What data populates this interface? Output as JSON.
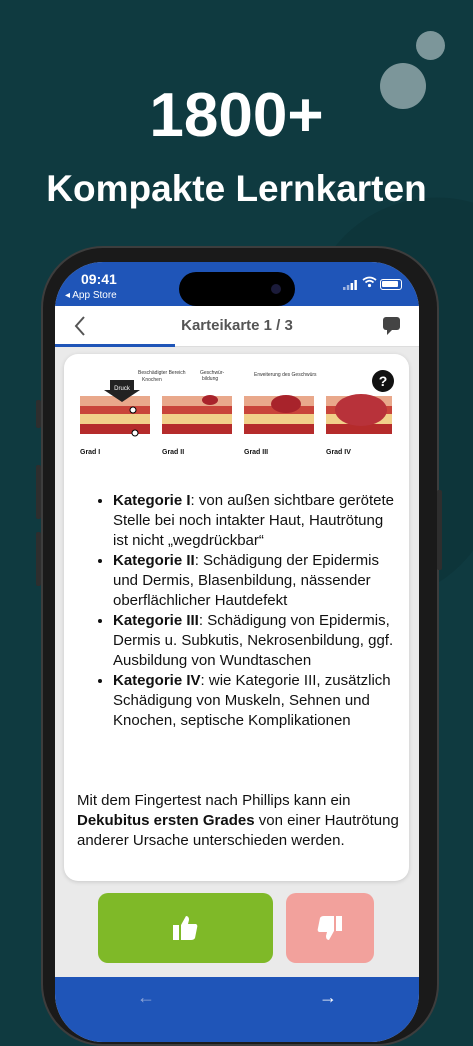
{
  "headline": {
    "number": "1800+",
    "subtitle": "Kompakte Lernkarten"
  },
  "status": {
    "time": "09:41",
    "back_app": "◂ App Store"
  },
  "nav": {
    "title": "Karteikarte 1 / 3"
  },
  "figure": {
    "druck": "Druck",
    "label_bereich": "Beschädigter Bereich",
    "label_knochen": "Knochen",
    "label_geschwuer": "Geschwür-",
    "label_bildung": "bildung",
    "label_erweiterung": "Erweiterung des Geschwürs",
    "grades": [
      "Grad I",
      "Grad II",
      "Grad III",
      "Grad IV"
    ]
  },
  "list": [
    {
      "bold": "Kategorie I",
      "text": ": von außen sichtbare gerötete Stelle bei noch intakter Haut, Hautrötung ist nicht „wegdrückbar“"
    },
    {
      "bold": "Kategorie II",
      "text": ": Schädigung der Epidermis und Dermis, Blasenbildung, nässender oberflächlicher Hautdefekt"
    },
    {
      "bold": "Kategorie III",
      "text": ": Schädigung von Epidermis, Dermis u. Subkutis, Nekrosenbildung, ggf. Ausbildung von Wundtaschen"
    },
    {
      "bold": "Kategorie IV",
      "text": ": wie Kategorie III, zusätzlich Schädigung von Muskeln, Sehnen und Knochen, septische Komplikationen"
    }
  ],
  "paragraph": {
    "before": "Mit dem Fingertest nach Phillips kann ein ",
    "bold": "Dekubitus ersten Grades",
    "after": " von einer Hautrötung anderer Ursache unterschieden werden."
  },
  "help_label": "?",
  "arrows": {
    "prev": "←",
    "next": "→"
  },
  "colors": {
    "background": "#0f3a40",
    "app_blue": "#1f55b8",
    "like_green": "#7fb928",
    "dislike_pink": "#f2a19c"
  },
  "icons": {
    "like": "thumbs-up-icon",
    "dislike": "thumbs-down-icon",
    "chat": "comment-icon",
    "back": "chevron-left-icon"
  }
}
